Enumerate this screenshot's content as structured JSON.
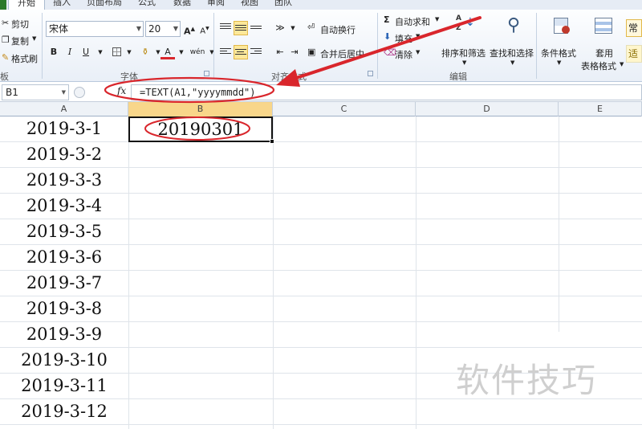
{
  "tabs": [
    "开始",
    "插入",
    "页面布局",
    "公式",
    "数据",
    "审阅",
    "视图",
    "团队"
  ],
  "ribbon": {
    "clipboard": {
      "cut": "剪切",
      "copy": "复制",
      "format_painter": "格式刷",
      "group_label": "板"
    },
    "font": {
      "font_name": "宋体",
      "font_size": "20",
      "bold": "B",
      "italic": "I",
      "underline": "U",
      "phonetic": "wén",
      "font_color": "A",
      "group_label": "字体"
    },
    "alignment": {
      "wrap_text": "自动换行",
      "merge_center": "合并后居中",
      "group_label": "对齐方式"
    },
    "editing": {
      "autosum": "自动求和",
      "fill": "填充",
      "clear": "清除",
      "sort_filter": "排序和筛选",
      "find_select": "查找和选择",
      "group_label": "编辑"
    },
    "styles": {
      "conditional_format": "条件格式",
      "table_format_line1": "套用",
      "table_format_line2": "表格格式",
      "style_normal": "常规",
      "style_good": "适"
    }
  },
  "formula_bar": {
    "name_box": "B1",
    "fx": "fx",
    "formula": "=TEXT(A1,\"yyyymmdd\")"
  },
  "columns": [
    "A",
    "B",
    "C",
    "D",
    "E"
  ],
  "rows": [
    "2019-3-1",
    "2019-3-2",
    "2019-3-3",
    "2019-3-4",
    "2019-3-5",
    "2019-3-6",
    "2019-3-7",
    "2019-3-8",
    "2019-3-9",
    "2019-3-10",
    "2019-3-11",
    "2019-3-12"
  ],
  "b1_value": "20190301",
  "watermark": "软件技巧",
  "colors": {
    "annotation_red": "#d9262c",
    "selected_header": "#f8d68a",
    "file_tab": "#2b7a2b"
  }
}
